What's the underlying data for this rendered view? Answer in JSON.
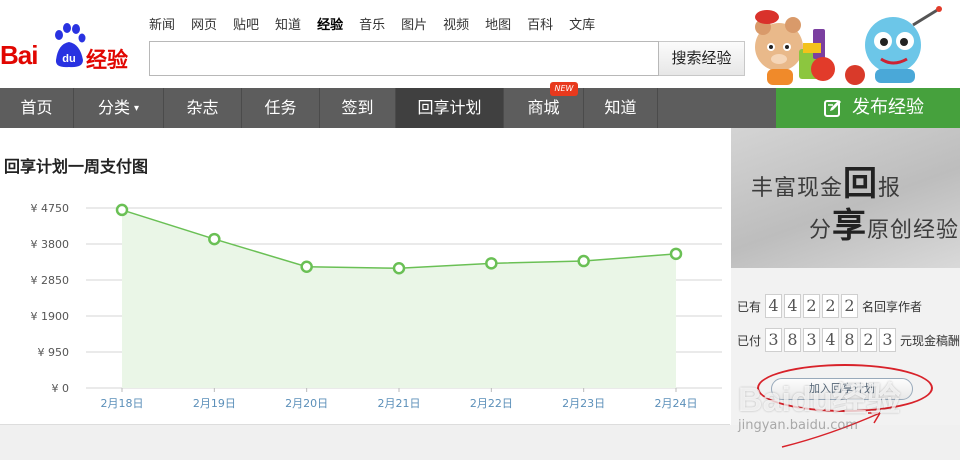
{
  "header": {
    "logo_text": "Bai",
    "logo_du": "du",
    "logo_product": "经验",
    "nav": [
      "新闻",
      "网页",
      "贴吧",
      "知道",
      "经验",
      "音乐",
      "图片",
      "视频",
      "地图",
      "百科",
      "文库"
    ],
    "nav_current": "经验",
    "search_value": "",
    "search_button": "搜索经验"
  },
  "mainnav": {
    "items": [
      "首页",
      "分类",
      "杂志",
      "任务",
      "签到",
      "回享计划",
      "商城",
      "知道"
    ],
    "active": "回享计划",
    "new_badge": "NEW",
    "publish": "发布经验"
  },
  "chart_data": {
    "type": "line",
    "title": "回享计划一周支付图",
    "categories": [
      "2月18日",
      "2月19日",
      "2月20日",
      "2月21日",
      "2月22日",
      "2月23日",
      "2月24日"
    ],
    "values": [
      4700,
      3930,
      3200,
      3160,
      3290,
      3350,
      3540
    ],
    "yticks": [
      "¥ 0",
      "¥ 950",
      "¥ 1900",
      "¥ 2850",
      "¥ 3800",
      "¥ 4750"
    ],
    "ylim": [
      0,
      4750
    ],
    "line_color": "#6ac055",
    "fill_color": "#eaf6e7",
    "grid": true
  },
  "sidebar": {
    "banner_line1": "丰富现金",
    "banner_big1": "回",
    "banner_line1_end": "报",
    "banner_line2": "分",
    "banner_big2": "享",
    "banner_line2_end": "原创经验",
    "authors_pre": "已有",
    "authors_digits": [
      "4",
      "4",
      "2",
      "2",
      "2"
    ],
    "authors_post": "名回享作者",
    "paid_pre": "已付",
    "paid_digits": [
      "3",
      "8",
      "3",
      "4",
      "8",
      "2",
      "3"
    ],
    "paid_post": "元现金稿酬",
    "join_button": "加入回享计划"
  },
  "watermark": {
    "brand": "Baidu经验",
    "url": "jingyan.baidu.com"
  }
}
